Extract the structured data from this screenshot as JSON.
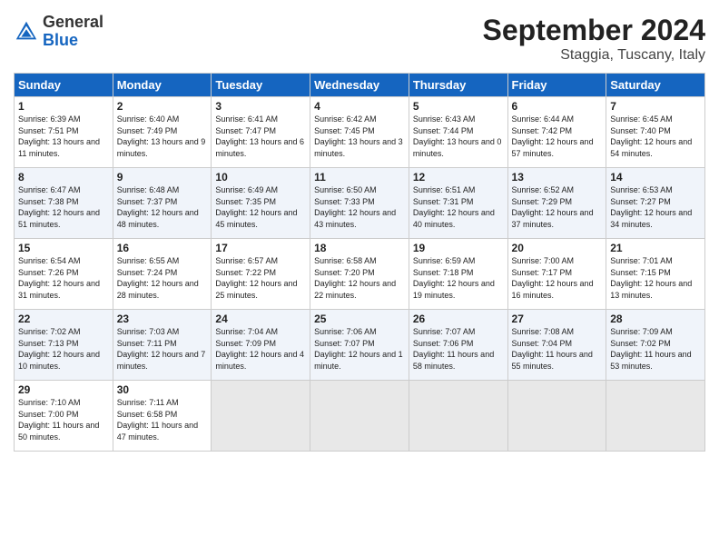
{
  "header": {
    "logo_general": "General",
    "logo_blue": "Blue",
    "month_title": "September 2024",
    "location": "Staggia, Tuscany, Italy"
  },
  "columns": [
    "Sunday",
    "Monday",
    "Tuesday",
    "Wednesday",
    "Thursday",
    "Friday",
    "Saturday"
  ],
  "weeks": [
    [
      {
        "day": "1",
        "sunrise": "Sunrise: 6:39 AM",
        "sunset": "Sunset: 7:51 PM",
        "daylight": "Daylight: 13 hours and 11 minutes."
      },
      {
        "day": "2",
        "sunrise": "Sunrise: 6:40 AM",
        "sunset": "Sunset: 7:49 PM",
        "daylight": "Daylight: 13 hours and 9 minutes."
      },
      {
        "day": "3",
        "sunrise": "Sunrise: 6:41 AM",
        "sunset": "Sunset: 7:47 PM",
        "daylight": "Daylight: 13 hours and 6 minutes."
      },
      {
        "day": "4",
        "sunrise": "Sunrise: 6:42 AM",
        "sunset": "Sunset: 7:45 PM",
        "daylight": "Daylight: 13 hours and 3 minutes."
      },
      {
        "day": "5",
        "sunrise": "Sunrise: 6:43 AM",
        "sunset": "Sunset: 7:44 PM",
        "daylight": "Daylight: 13 hours and 0 minutes."
      },
      {
        "day": "6",
        "sunrise": "Sunrise: 6:44 AM",
        "sunset": "Sunset: 7:42 PM",
        "daylight": "Daylight: 12 hours and 57 minutes."
      },
      {
        "day": "7",
        "sunrise": "Sunrise: 6:45 AM",
        "sunset": "Sunset: 7:40 PM",
        "daylight": "Daylight: 12 hours and 54 minutes."
      }
    ],
    [
      {
        "day": "8",
        "sunrise": "Sunrise: 6:47 AM",
        "sunset": "Sunset: 7:38 PM",
        "daylight": "Daylight: 12 hours and 51 minutes."
      },
      {
        "day": "9",
        "sunrise": "Sunrise: 6:48 AM",
        "sunset": "Sunset: 7:37 PM",
        "daylight": "Daylight: 12 hours and 48 minutes."
      },
      {
        "day": "10",
        "sunrise": "Sunrise: 6:49 AM",
        "sunset": "Sunset: 7:35 PM",
        "daylight": "Daylight: 12 hours and 45 minutes."
      },
      {
        "day": "11",
        "sunrise": "Sunrise: 6:50 AM",
        "sunset": "Sunset: 7:33 PM",
        "daylight": "Daylight: 12 hours and 43 minutes."
      },
      {
        "day": "12",
        "sunrise": "Sunrise: 6:51 AM",
        "sunset": "Sunset: 7:31 PM",
        "daylight": "Daylight: 12 hours and 40 minutes."
      },
      {
        "day": "13",
        "sunrise": "Sunrise: 6:52 AM",
        "sunset": "Sunset: 7:29 PM",
        "daylight": "Daylight: 12 hours and 37 minutes."
      },
      {
        "day": "14",
        "sunrise": "Sunrise: 6:53 AM",
        "sunset": "Sunset: 7:27 PM",
        "daylight": "Daylight: 12 hours and 34 minutes."
      }
    ],
    [
      {
        "day": "15",
        "sunrise": "Sunrise: 6:54 AM",
        "sunset": "Sunset: 7:26 PM",
        "daylight": "Daylight: 12 hours and 31 minutes."
      },
      {
        "day": "16",
        "sunrise": "Sunrise: 6:55 AM",
        "sunset": "Sunset: 7:24 PM",
        "daylight": "Daylight: 12 hours and 28 minutes."
      },
      {
        "day": "17",
        "sunrise": "Sunrise: 6:57 AM",
        "sunset": "Sunset: 7:22 PM",
        "daylight": "Daylight: 12 hours and 25 minutes."
      },
      {
        "day": "18",
        "sunrise": "Sunrise: 6:58 AM",
        "sunset": "Sunset: 7:20 PM",
        "daylight": "Daylight: 12 hours and 22 minutes."
      },
      {
        "day": "19",
        "sunrise": "Sunrise: 6:59 AM",
        "sunset": "Sunset: 7:18 PM",
        "daylight": "Daylight: 12 hours and 19 minutes."
      },
      {
        "day": "20",
        "sunrise": "Sunrise: 7:00 AM",
        "sunset": "Sunset: 7:17 PM",
        "daylight": "Daylight: 12 hours and 16 minutes."
      },
      {
        "day": "21",
        "sunrise": "Sunrise: 7:01 AM",
        "sunset": "Sunset: 7:15 PM",
        "daylight": "Daylight: 12 hours and 13 minutes."
      }
    ],
    [
      {
        "day": "22",
        "sunrise": "Sunrise: 7:02 AM",
        "sunset": "Sunset: 7:13 PM",
        "daylight": "Daylight: 12 hours and 10 minutes."
      },
      {
        "day": "23",
        "sunrise": "Sunrise: 7:03 AM",
        "sunset": "Sunset: 7:11 PM",
        "daylight": "Daylight: 12 hours and 7 minutes."
      },
      {
        "day": "24",
        "sunrise": "Sunrise: 7:04 AM",
        "sunset": "Sunset: 7:09 PM",
        "daylight": "Daylight: 12 hours and 4 minutes."
      },
      {
        "day": "25",
        "sunrise": "Sunrise: 7:06 AM",
        "sunset": "Sunset: 7:07 PM",
        "daylight": "Daylight: 12 hours and 1 minute."
      },
      {
        "day": "26",
        "sunrise": "Sunrise: 7:07 AM",
        "sunset": "Sunset: 7:06 PM",
        "daylight": "Daylight: 11 hours and 58 minutes."
      },
      {
        "day": "27",
        "sunrise": "Sunrise: 7:08 AM",
        "sunset": "Sunset: 7:04 PM",
        "daylight": "Daylight: 11 hours and 55 minutes."
      },
      {
        "day": "28",
        "sunrise": "Sunrise: 7:09 AM",
        "sunset": "Sunset: 7:02 PM",
        "daylight": "Daylight: 11 hours and 53 minutes."
      }
    ],
    [
      {
        "day": "29",
        "sunrise": "Sunrise: 7:10 AM",
        "sunset": "Sunset: 7:00 PM",
        "daylight": "Daylight: 11 hours and 50 minutes."
      },
      {
        "day": "30",
        "sunrise": "Sunrise: 7:11 AM",
        "sunset": "Sunset: 6:58 PM",
        "daylight": "Daylight: 11 hours and 47 minutes."
      },
      null,
      null,
      null,
      null,
      null
    ]
  ]
}
